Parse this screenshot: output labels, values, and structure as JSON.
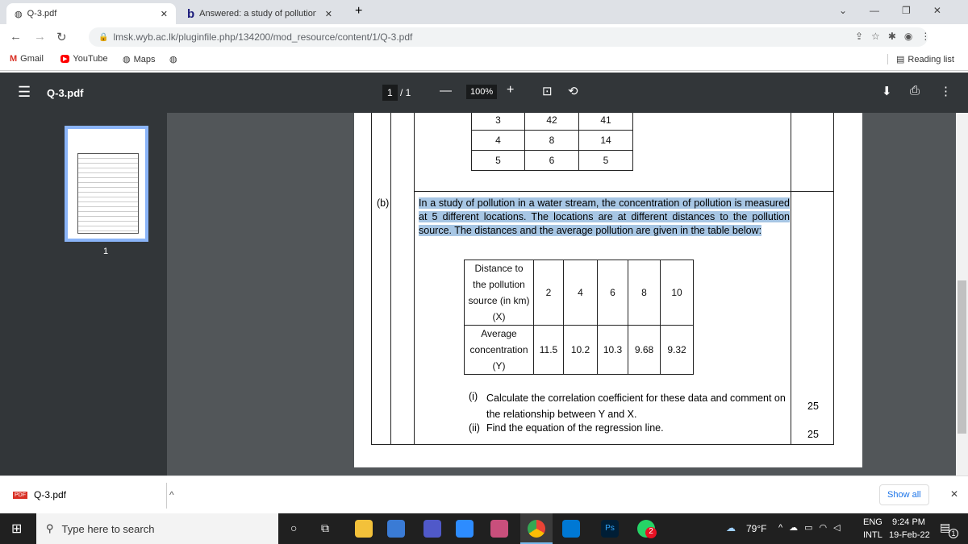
{
  "browser": {
    "tabs": [
      {
        "title": "Q-3.pdf",
        "active": true
      },
      {
        "title": "Answered: a study of pollution in",
        "active": false
      }
    ],
    "url": "lmsk.wyb.ac.lk/pluginfile.php/134200/mod_resource/content/1/Q-3.pdf",
    "bookmarks": [
      "Gmail",
      "YouTube",
      "Maps"
    ],
    "reading_list": "Reading list"
  },
  "pdf": {
    "title": "Q-3.pdf",
    "page_current": "1",
    "page_total": "/ 1",
    "zoom": "100%",
    "thumb_label": "1",
    "prev_table": [
      [
        "3",
        "42",
        "41"
      ],
      [
        "4",
        "8",
        "14"
      ],
      [
        "5",
        "6",
        "5"
      ]
    ],
    "part_label": "(b)",
    "paragraph": "In a study of pollution in a water stream, the concentration of pollution is measured at 5 different locations. The locations are at different distances to the pollution source. The distances and the average pollution are given in the table below:",
    "table": {
      "x_header": "Distance to the pollution source (in km) (X)",
      "x_values": [
        "2",
        "4",
        "6",
        "8",
        "10"
      ],
      "y_header": "Average concentration (Y)",
      "y_values": [
        "11.5",
        "10.2",
        "10.3",
        "9.68",
        "9.32"
      ]
    },
    "questions": [
      {
        "label": "(i)",
        "text": "Calculate the correlation coefficient for these data and comment on the relationship between Y and X.",
        "marks": "25"
      },
      {
        "label": "(ii)",
        "text": "Find the equation of the regression line.",
        "marks": "25"
      }
    ]
  },
  "download": {
    "file": "Q-3.pdf",
    "show_all": "Show all"
  },
  "taskbar": {
    "search_placeholder": "Type here to search",
    "weather": "79°F",
    "lang1": "ENG",
    "lang2": "INTL",
    "time": "9:24 PM",
    "date": "19-Feb-22",
    "whatsapp_badge": "2",
    "notif_count": "1"
  }
}
